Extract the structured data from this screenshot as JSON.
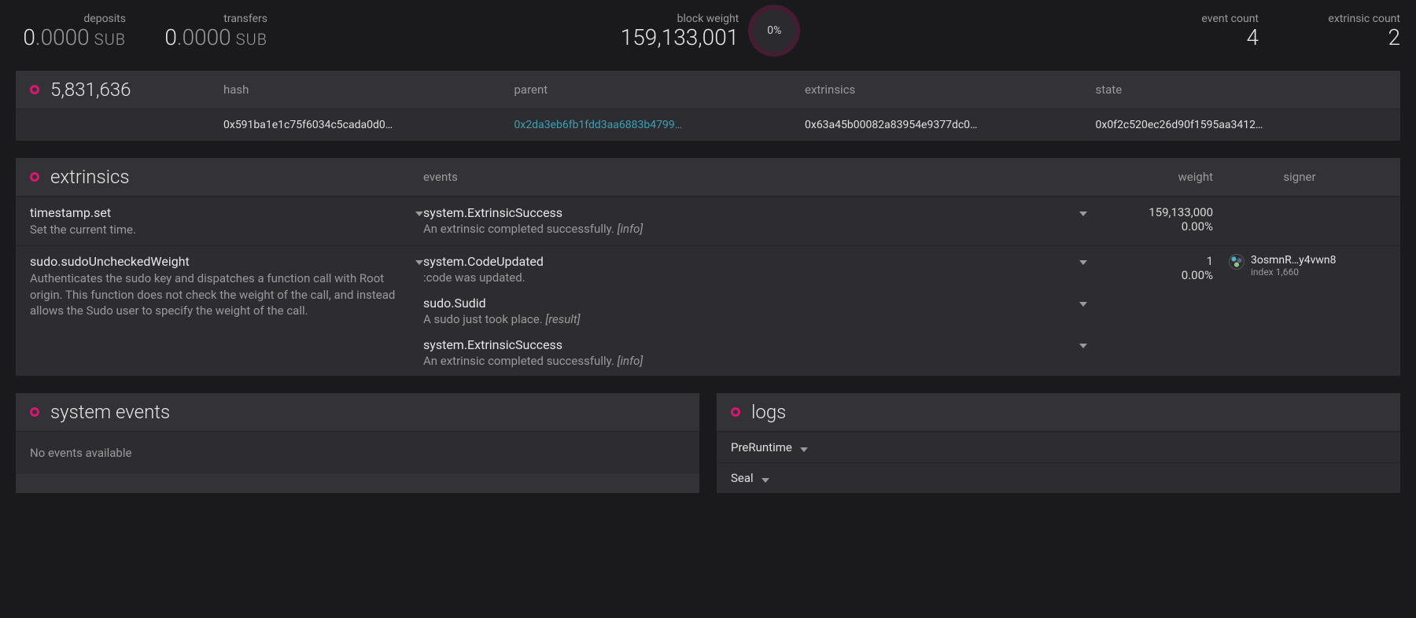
{
  "summary": {
    "deposits": {
      "label": "deposits",
      "int": "0",
      "frac": ".0000",
      "unit": "SUB"
    },
    "transfers": {
      "label": "transfers",
      "int": "0",
      "frac": ".0000",
      "unit": "SUB"
    },
    "block_weight": {
      "label": "block weight",
      "value": "159,133,001",
      "gauge": "0%"
    },
    "event_count": {
      "label": "event count",
      "value": "4"
    },
    "extrinsic_count": {
      "label": "extrinsic count",
      "value": "2"
    }
  },
  "block": {
    "number": "5,831,636",
    "columns": {
      "hash": "hash",
      "parent": "parent",
      "extrinsics": "extrinsics",
      "state": "state"
    },
    "hash": "0x591ba1e1c75f6034c5cada0d0…",
    "parent": "0x2da3eb6fb1fdd3aa6883b4799…",
    "extrinsics": "0x63a45b00082a83954e9377dc0…",
    "state": "0x0f2c520ec26d90f1595aa3412…"
  },
  "extrinsics_panel": {
    "title": "extrinsics",
    "headers": {
      "events": "events",
      "weight": "weight",
      "signer": "signer"
    },
    "rows": [
      {
        "name": "timestamp.set",
        "desc": "Set the current time.",
        "events": [
          {
            "name": "system.ExtrinsicSuccess",
            "desc": "An extrinsic completed successfully.",
            "param": "[info]"
          }
        ],
        "weight_value": "159,133,000",
        "weight_pct": "0.00%",
        "signer": null
      },
      {
        "name": "sudo.sudoUncheckedWeight",
        "desc": "Authenticates the sudo key and dispatches a function call with Root origin. This function does not check the weight of the call, and instead allows the Sudo user to specify the weight of the call.",
        "events": [
          {
            "name": "system.CodeUpdated",
            "desc": ":code was updated.",
            "param": ""
          },
          {
            "name": "sudo.Sudid",
            "desc": "A sudo just took place.",
            "param": "[result]"
          },
          {
            "name": "system.ExtrinsicSuccess",
            "desc": "An extrinsic completed successfully.",
            "param": "[info]"
          }
        ],
        "weight_value": "1",
        "weight_pct": "0.00%",
        "signer": {
          "name": "3osmnR…y4vwn8",
          "sub": "index 1,660"
        }
      }
    ]
  },
  "system_events": {
    "title": "system events",
    "empty": "No events available"
  },
  "logs": {
    "title": "logs",
    "items": [
      "PreRuntime",
      "Seal"
    ]
  }
}
